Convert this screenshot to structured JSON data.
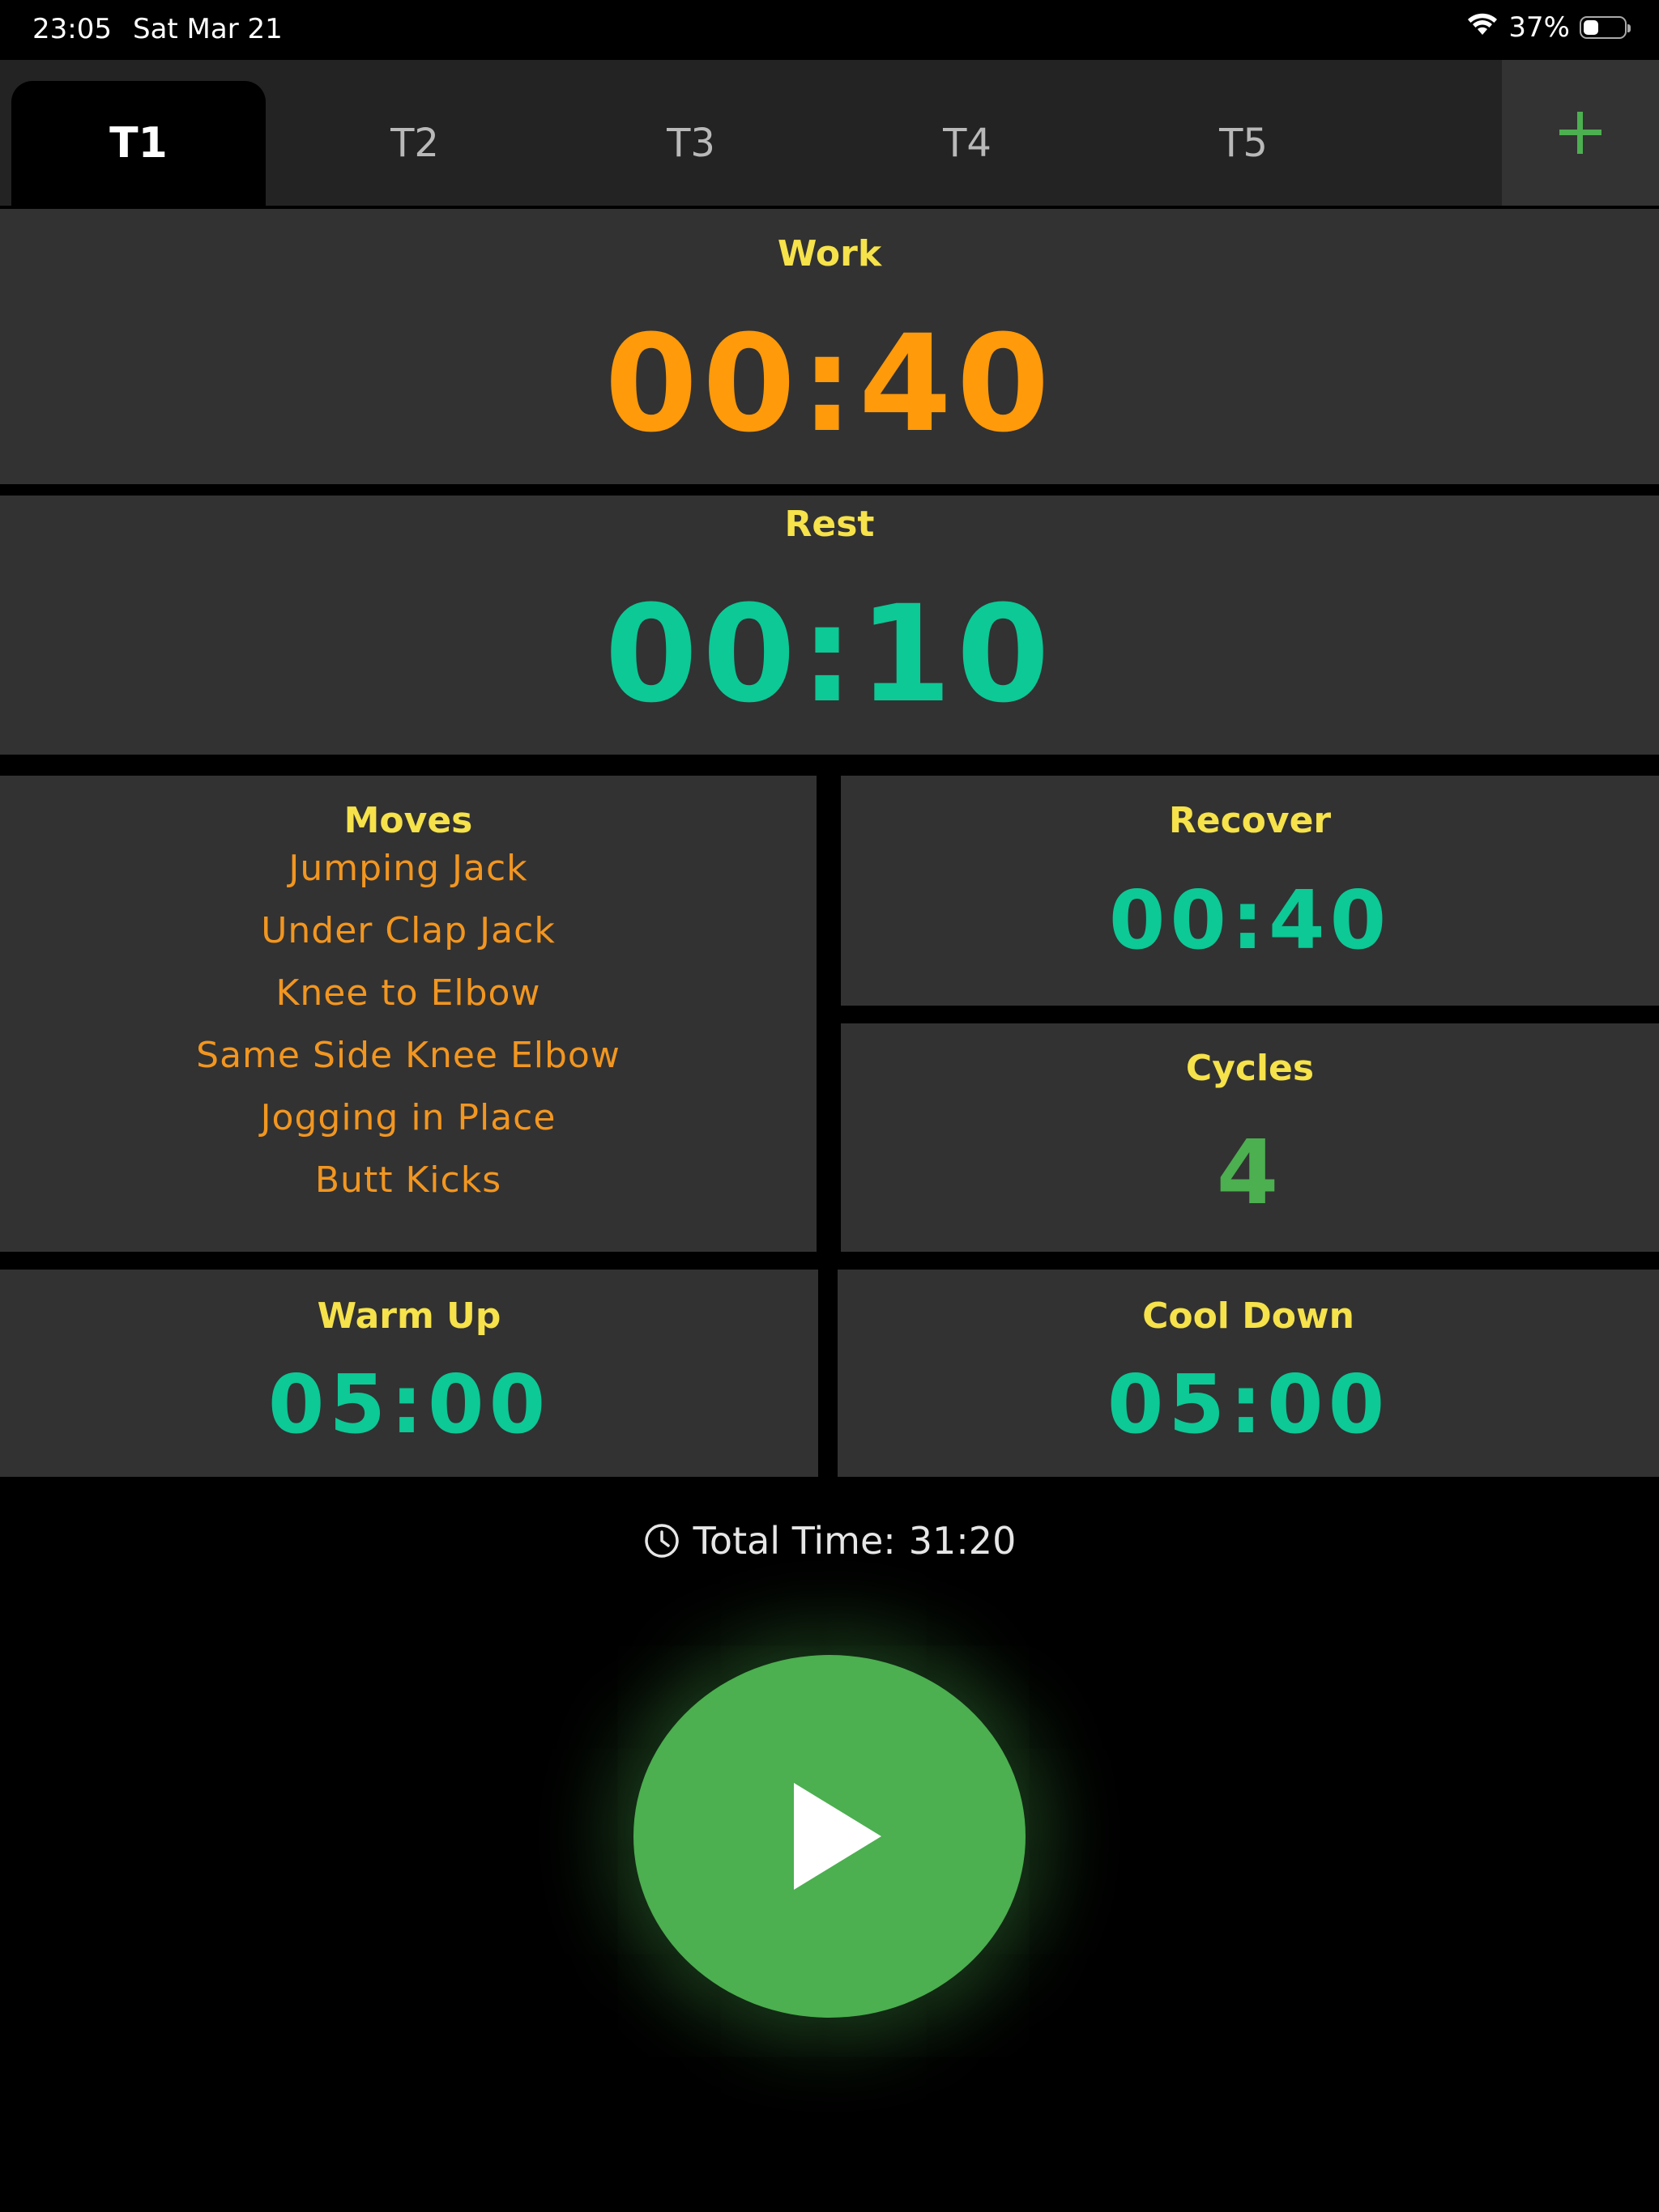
{
  "status_bar": {
    "time": "23:05",
    "date": "Sat Mar 21",
    "battery_percent": "37%",
    "battery_level": 0.37
  },
  "tabs": [
    {
      "label": "T1",
      "active": true
    },
    {
      "label": "T2",
      "active": false
    },
    {
      "label": "T3",
      "active": false
    },
    {
      "label": "T4",
      "active": false
    },
    {
      "label": "T5",
      "active": false
    }
  ],
  "add_tab_icon": "plus-icon",
  "work": {
    "label": "Work",
    "time": "00:40"
  },
  "rest": {
    "label": "Rest",
    "time": "00:10"
  },
  "moves": {
    "label": "Moves",
    "items": [
      "Jumping Jack",
      "Under Clap Jack",
      "Knee to Elbow",
      "Same Side Knee Elbow",
      "Jogging in Place",
      "Butt Kicks"
    ]
  },
  "recover": {
    "label": "Recover",
    "time": "00:40"
  },
  "cycles": {
    "label": "Cycles",
    "value": "4"
  },
  "warm_up": {
    "label": "Warm Up",
    "time": "05:00"
  },
  "cool_down": {
    "label": "Cool Down",
    "time": "05:00"
  },
  "total_time": {
    "label": "Total Time:",
    "value": "31:20"
  },
  "colors": {
    "label_yellow": "#f6e24a",
    "work_orange": "#ff9a0a",
    "time_teal": "#0cc996",
    "accent_green": "#4caf50",
    "panel_bg": "#323232"
  }
}
